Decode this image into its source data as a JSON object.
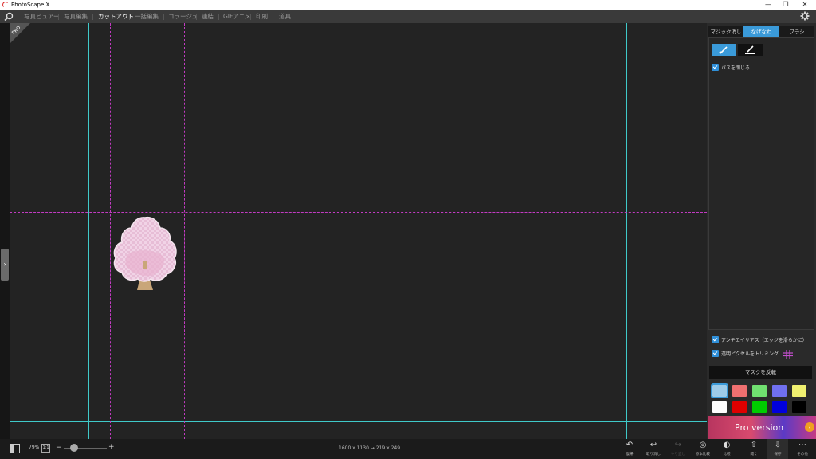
{
  "window": {
    "title": "PhotoScape X",
    "minimize": "—",
    "maximize": "❐",
    "close": "✕"
  },
  "menu": {
    "items": [
      "写真ビュアー",
      "写真編集",
      "カットアウト",
      "一括編集",
      "コラージュ",
      "連結",
      "GIFアニメ",
      "印刷",
      "道具"
    ],
    "active_index": 2
  },
  "canvas": {
    "pro_badge": "PRO",
    "background": "#232323"
  },
  "right_panel": {
    "tabs": [
      "マジック消しゴム",
      "なげなわ",
      "ブラシ"
    ],
    "active_tab": 1,
    "close_path_label": "パスを閉じる",
    "antialias_label": "アンチエイリアス（エッジを滑らかに）",
    "trim_label": "透明ピクセルをトリミング",
    "invert_mask_label": "マスクを反転",
    "swatches": [
      {
        "name": "transparent",
        "color": "#9ecbe8"
      },
      {
        "name": "light-red",
        "color": "#f07070"
      },
      {
        "name": "light-green",
        "color": "#70e070"
      },
      {
        "name": "light-blue",
        "color": "#7070f0"
      },
      {
        "name": "light-yellow",
        "color": "#f0f070"
      },
      {
        "name": "white",
        "color": "#ffffff"
      },
      {
        "name": "red",
        "color": "#e00000"
      },
      {
        "name": "green",
        "color": "#00cc00"
      },
      {
        "name": "blue",
        "color": "#0000dd"
      },
      {
        "name": "black",
        "color": "#000000"
      }
    ],
    "ad_text": "Pro version"
  },
  "bottom": {
    "zoom": "79%",
    "one_to_one": "1:1",
    "minus": "−",
    "plus": "+",
    "size_info": "1600 x 1130 → 219 x 249",
    "actions": [
      {
        "glyph": "↶",
        "label": "復帰",
        "dim": false
      },
      {
        "glyph": "↩",
        "label": "取り消し",
        "dim": false
      },
      {
        "glyph": "↪",
        "label": "やり直し",
        "dim": true
      },
      {
        "glyph": "◎",
        "label": "原本比較",
        "dim": false
      },
      {
        "glyph": "◐",
        "label": "比較",
        "dim": false
      },
      {
        "glyph": "⇧",
        "label": "開く",
        "dim": false
      },
      {
        "glyph": "⇩",
        "label": "保存",
        "dim": false
      },
      {
        "glyph": "⋯",
        "label": "その他",
        "dim": false
      }
    ]
  },
  "colors": {
    "accent": "#3a9ad9",
    "guide_cyan": "#3fc9c9",
    "guide_magenta": "#c23bc2"
  }
}
